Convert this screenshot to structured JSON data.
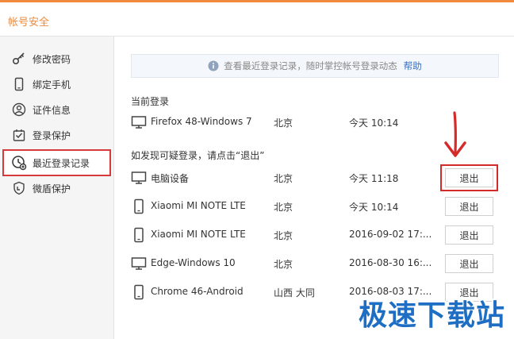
{
  "header": {
    "title": "帐号安全"
  },
  "sidebar": {
    "items": [
      {
        "label": "修改密码",
        "icon": "key-icon"
      },
      {
        "label": "绑定手机",
        "icon": "phone-icon"
      },
      {
        "label": "证件信息",
        "icon": "id-card-icon"
      },
      {
        "label": "登录保护",
        "icon": "login-protect-icon"
      },
      {
        "label": "最近登录记录",
        "icon": "recent-login-icon",
        "active": true
      },
      {
        "label": "微盾保护",
        "icon": "shield-icon"
      }
    ]
  },
  "notice": {
    "text": "查看最近登录记录，随时掌控帐号登录动态",
    "link": "帮助"
  },
  "current": {
    "title": "当前登录",
    "device": "Firefox 48-Windows 7",
    "location": "北京",
    "time": "今天 10:14",
    "device_type": "desktop"
  },
  "suspicious": {
    "title": "如发现可疑登录，请点击“退出”",
    "logout_label": "退出",
    "rows": [
      {
        "device": "电脑设备",
        "location": "北京",
        "time": "今天 11:18",
        "device_type": "desktop",
        "highlighted": true
      },
      {
        "device": "Xiaomi MI NOTE LTE",
        "location": "北京",
        "time": "今天 10:14",
        "device_type": "mobile"
      },
      {
        "device": "Xiaomi MI NOTE LTE",
        "location": "北京",
        "time": "2016-09-02 17:...",
        "device_type": "mobile"
      },
      {
        "device": "Edge-Windows 10",
        "location": "北京",
        "time": "2016-08-30 16:...",
        "device_type": "desktop"
      },
      {
        "device": "Chrome 46-Android",
        "location": "山西 大同",
        "time": "2016-08-03 17:...",
        "device_type": "mobile"
      }
    ]
  },
  "watermark": "极速下载站",
  "colors": {
    "accent": "#f08a3c",
    "highlight": "#d42a2a",
    "link": "#3a6fbf",
    "watermark": "#1e6fc4"
  }
}
